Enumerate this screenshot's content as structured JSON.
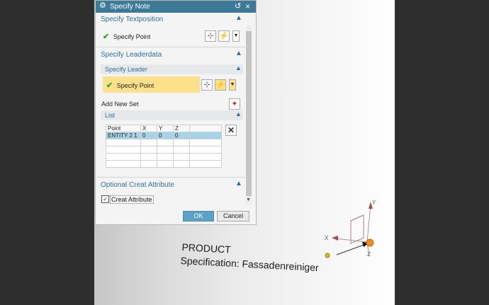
{
  "dialog": {
    "title": "Specify Note",
    "sections": {
      "textposition": {
        "title": "Specify Textposition",
        "point_label": "Specify Point"
      },
      "leaderdata": {
        "title": "Specify Leaderdata",
        "sub_title": "Specify Leader",
        "point_label": "Specify Point",
        "add_new_set": "Add New Set"
      },
      "list": {
        "title": "List",
        "columns": [
          "Point",
          "X",
          "Y",
          "Z"
        ],
        "rows": [
          [
            "ENTITY 2 1",
            "0",
            "0",
            "0"
          ]
        ]
      },
      "optional": {
        "title": "Optional Creat Attribute",
        "checkbox_label": "Creat Attribute",
        "checked": true
      }
    },
    "buttons": {
      "ok": "OK",
      "cancel": "Cancel"
    }
  },
  "viewport": {
    "note_line1": "PRODUCT",
    "note_line2": "Specification: Fassadenreiniger",
    "axes": {
      "x": "X",
      "y": "Y",
      "z": "Z"
    }
  },
  "colors": {
    "accent": "#3d7a98",
    "check": "#29a12b",
    "highlight": "#fde08c",
    "selected_row": "#a7d3e6"
  }
}
